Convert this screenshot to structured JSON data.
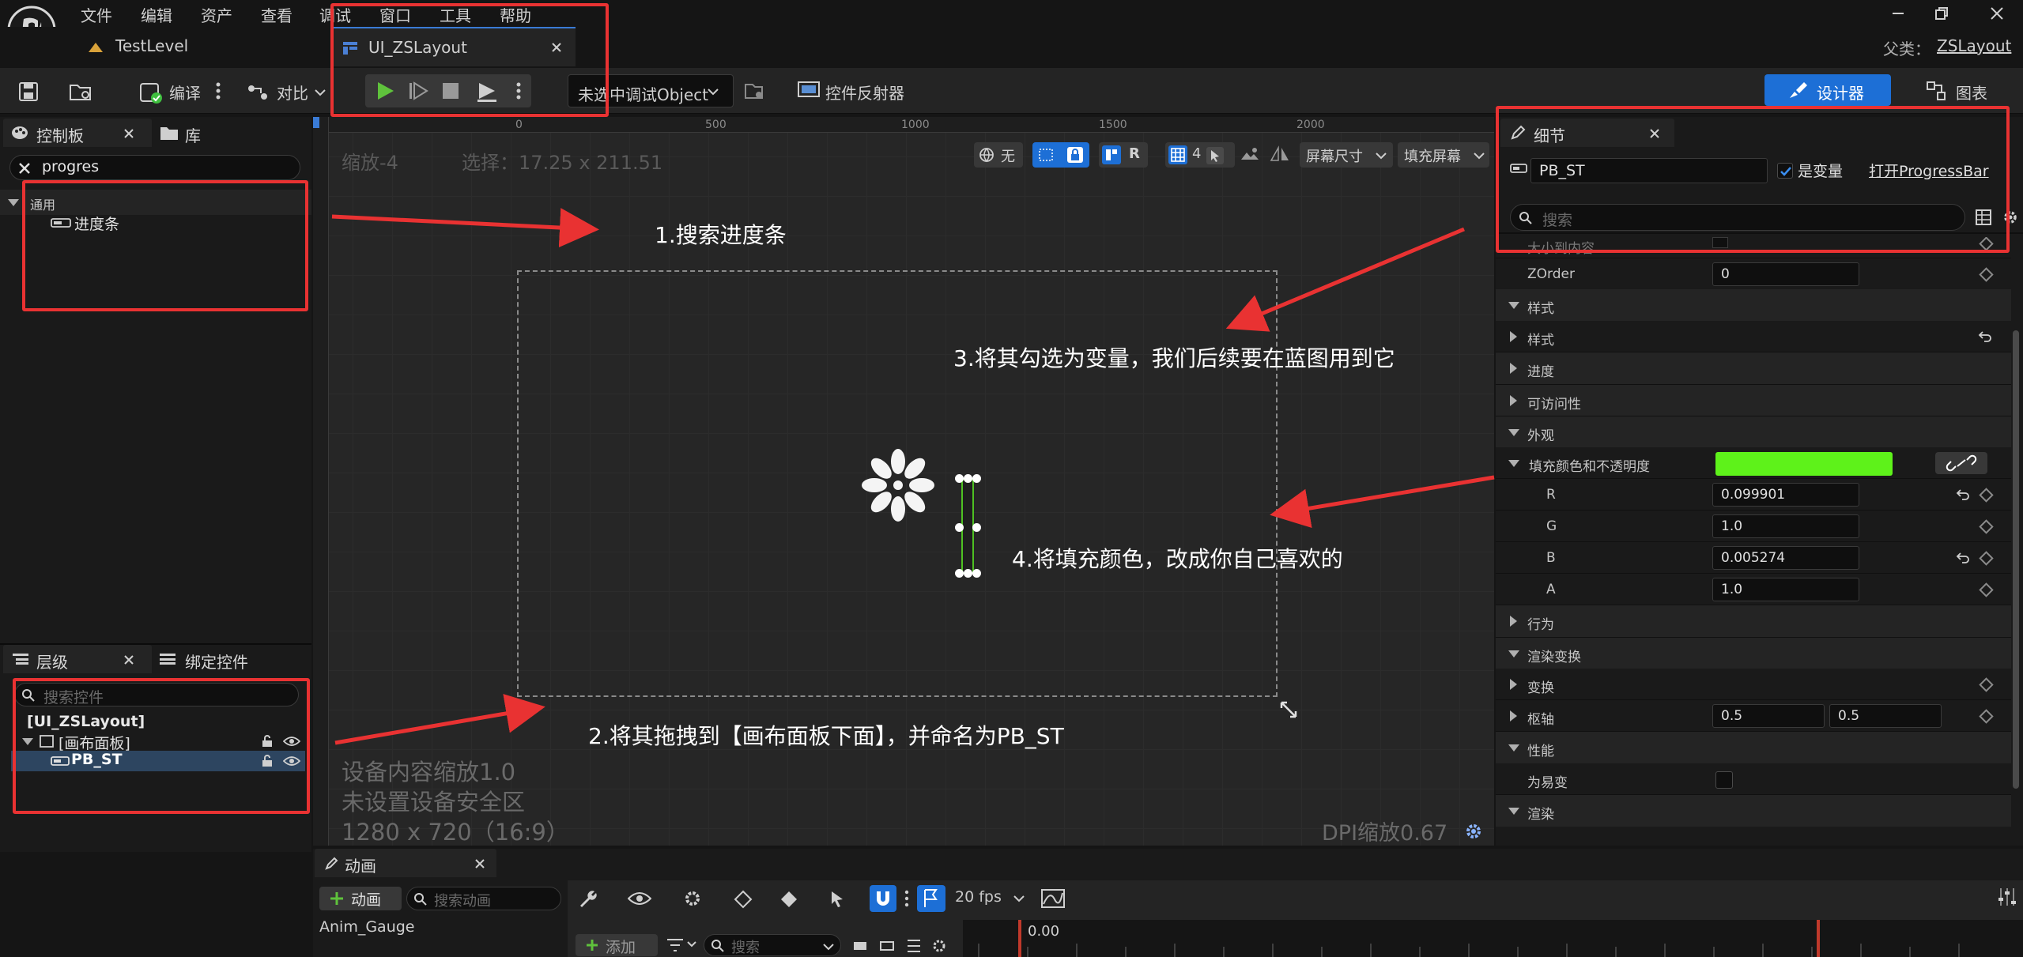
{
  "menu": [
    "文件",
    "编辑",
    "资产",
    "查看",
    "调试",
    "窗口",
    "工具",
    "帮助"
  ],
  "tabs": {
    "level": "TestLevel",
    "widget": "UI_ZSLayout"
  },
  "parent": {
    "label": "父类：",
    "value": "ZSLayout"
  },
  "toolbar": {
    "compile": "编译",
    "diff": "对比",
    "debug_object": "未选中调试Object",
    "reflector": "控件反射器",
    "designer": "设计器",
    "graph": "图表"
  },
  "palette": {
    "tab_palette": "控制板",
    "tab_library": "库",
    "search_value": "progres",
    "category": "通用",
    "item": "进度条"
  },
  "hierarchy": {
    "tab_hierarchy": "层级",
    "tab_bind": "绑定控件",
    "search_placeholder": "搜索控件",
    "root": "[UI_ZSLayout]",
    "canvas": "[画布面板]",
    "pb": "PB_ST"
  },
  "viewport": {
    "zoom": "缩放-4",
    "selection": "选择：17.25 x 211.51",
    "none_label": "无",
    "r_label": "R",
    "grid_count": "4",
    "screen_size": "屏幕尺寸",
    "fill_screen": "填充屏幕",
    "ruler_top": [
      "0",
      "500",
      "1000",
      "1500",
      "2000"
    ],
    "device_scale": "设备内容缩放1.0",
    "safe_zone": "未设置设备安全区",
    "resolution": "1280 x 720（16:9）",
    "dpi": "DPI缩放0.67"
  },
  "annotations": {
    "a1": "1.搜索进度条",
    "a2": "2.将其拖拽到【画布面板下面】，并命名为PB_ST",
    "a3": "3.将其勾选为变量，我们后续要在蓝图用到它",
    "a4": "4.将填充颜色，改成你自己喜欢的"
  },
  "details": {
    "tab": "细节",
    "name_value": "PB_ST",
    "is_variable": "是变量",
    "open_link": "打开ProgressBar",
    "search_placeholder": "搜索",
    "rows": {
      "size_to_content": "大小到内容",
      "zorder": "ZOrder",
      "zorder_value": "0",
      "style_cat": "样式",
      "style": "样式",
      "progress": "进度",
      "accessibility": "可访问性",
      "appearance": "外观",
      "fill_color": "填充颜色和不透明度",
      "r": "R",
      "r_value": "0.099901",
      "g": "G",
      "g_value": "1.0",
      "b": "B",
      "b_value": "0.005274",
      "a": "A",
      "a_value": "1.0",
      "behavior": "行为",
      "render_transform": "渲染变换",
      "transform": "变换",
      "pivot": "枢轴",
      "pivot_x": "0.5",
      "pivot_y": "0.5",
      "performance": "性能",
      "volatile": "为易变",
      "rendering": "渲染"
    },
    "fill_color_hex": "#5ef21a"
  },
  "animation": {
    "tab": "动画",
    "add_anim": "动画",
    "search_placeholder": "搜索动画",
    "item": "Anim_Gauge",
    "fps": "20 fps",
    "add": "添加",
    "search2_placeholder": "搜索",
    "time": "0.00"
  }
}
